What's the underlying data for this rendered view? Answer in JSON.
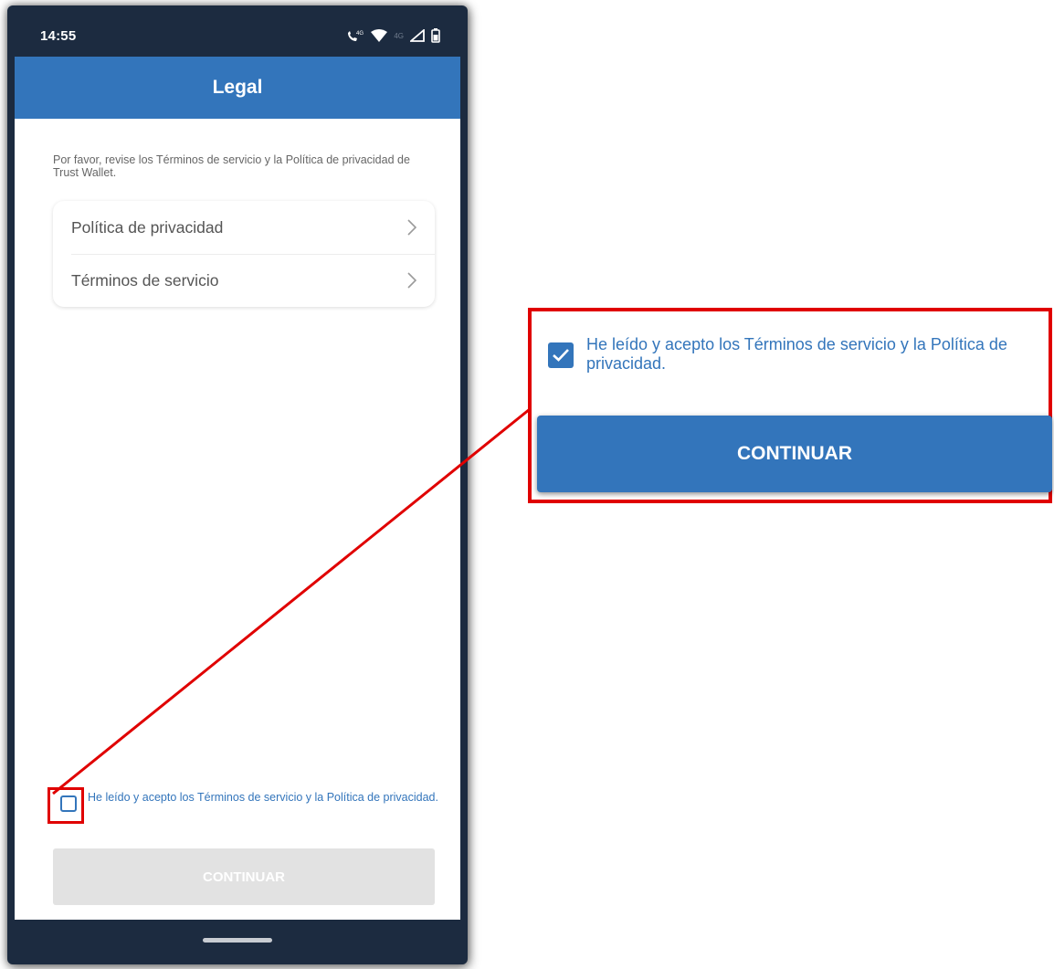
{
  "status_bar": {
    "time": "14:55",
    "icons": [
      "volte-icon",
      "wifi-icon",
      "signal-icon",
      "battery-icon"
    ],
    "network_label": "4G"
  },
  "app_bar": {
    "title": "Legal"
  },
  "intro_text": "Por favor, revise los Términos de servicio y la Política de privacidad de Trust Wallet.",
  "links": [
    {
      "label": "Política de privacidad"
    },
    {
      "label": "Términos de servicio"
    }
  ],
  "consent": {
    "text": "He leído y acepto los Términos de servicio y la Política de privacidad.",
    "checked": false
  },
  "continue_button": {
    "label": "CONTINUAR",
    "enabled": false
  },
  "zoom": {
    "consent_text": "He leído y acepto los Términos de servicio y la Política de privacidad.",
    "checked": true,
    "continue_label": "CONTINUAR"
  },
  "colors": {
    "primary": "#3375bb",
    "dark_bar": "#1c2b40",
    "highlight": "#e00000",
    "disabled": "#e2e2e2"
  }
}
